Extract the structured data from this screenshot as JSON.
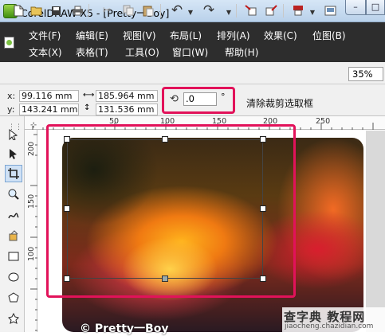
{
  "window": {
    "title": "CorelDRAW X5 - [Pretty一Boy]",
    "min_symbol": "–",
    "max_symbol": "□"
  },
  "menu": {
    "row1": [
      "文件(F)",
      "编辑(E)",
      "视图(V)",
      "布局(L)",
      "排列(A)",
      "效果(C)",
      "位图(B)"
    ],
    "row2": [
      "文本(X)",
      "表格(T)",
      "工具(O)",
      "窗口(W)",
      "帮助(H)"
    ]
  },
  "toolbar": {
    "zoom": "35%",
    "icons": [
      "new-icon",
      "open-icon",
      "save-icon",
      "print-icon",
      "cut-icon",
      "copy-icon",
      "paste-icon",
      "undo-icon",
      "redo-icon",
      "import-icon",
      "export-icon",
      "publish-icon",
      "app-launcher-icon",
      "zoom-level"
    ]
  },
  "property_bar": {
    "x_label": "x:",
    "x_value": "99.116 mm",
    "y_label": "y:",
    "y_value": "143.241 mm",
    "width_value": "185.964 mm",
    "height_value": "131.536 mm",
    "rotation_value": ".0",
    "degree": "°",
    "clear_crop": "清除裁剪选取框"
  },
  "ruler": {
    "top_labels": [
      "50",
      "100",
      "150",
      "200",
      "250"
    ],
    "left_labels": [
      "200",
      "150",
      "100"
    ]
  },
  "photo": {
    "caption": "© Pretty一Boy"
  },
  "watermark": {
    "main": "查字典 教程网",
    "url": "jiaocheng.chazidian.com"
  },
  "colors": {
    "highlight": "#e2125a",
    "menu_bg": "#2d2d2d",
    "title_bg": "#c7dbef"
  }
}
